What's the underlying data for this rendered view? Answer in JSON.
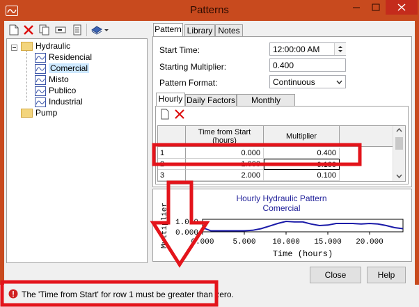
{
  "window": {
    "title": "Patterns"
  },
  "toolbar": {
    "icons": [
      "new-document-icon",
      "delete-icon",
      "copy-icon",
      "rename-icon",
      "properties-icon",
      "library-icon",
      "chevron-down-icon"
    ]
  },
  "tree": {
    "root": "Hydraulic",
    "items": [
      "Residencial",
      "Comercial",
      "Misto",
      "Publico",
      "Industrial"
    ],
    "selected": "Comercial",
    "other": "Pump"
  },
  "tabs": {
    "pattern": "Pattern",
    "library": "Library",
    "notes": "Notes"
  },
  "form": {
    "start_time_label": "Start Time:",
    "start_time": "12:00:00 AM",
    "multiplier_label": "Starting Multiplier:",
    "multiplier": "0.400",
    "format_label": "Pattern Format:",
    "format": "Continuous"
  },
  "subtabs": {
    "hourly": "Hourly",
    "daily": "Daily Factors",
    "monthly": "Monthly Factors"
  },
  "table": {
    "headers": [
      "Time from Start\n(hours)",
      "Multiplier"
    ],
    "rows": [
      {
        "index": "1",
        "time": "0.000",
        "multiplier": "0.400"
      },
      {
        "index": "2",
        "time": "1.000",
        "multiplier": "0.100"
      },
      {
        "index": "3",
        "time": "2.000",
        "multiplier": "0.100"
      }
    ]
  },
  "chart_data": {
    "type": "line",
    "title": "Hourly Hydraulic Pattern",
    "subtitle": "Comercial",
    "xlabel": "Time (hours)",
    "ylabel": "Multiplier",
    "xlim": [
      0,
      24
    ],
    "ylim": [
      0,
      1.2
    ],
    "xticks": [
      "0.000",
      "5.000",
      "10.000",
      "15.000",
      "20.000"
    ],
    "yticks": [
      "0.000",
      "1.000"
    ],
    "x": [
      0,
      1,
      2,
      3,
      4,
      5,
      6,
      7,
      8,
      9,
      10,
      11,
      12,
      13,
      14,
      15,
      16,
      17,
      18,
      19,
      20,
      21,
      22,
      23,
      24
    ],
    "values": [
      0.4,
      0.1,
      0.1,
      0.1,
      0.1,
      0.1,
      0.15,
      0.3,
      0.55,
      0.8,
      1.0,
      0.95,
      0.95,
      0.75,
      0.6,
      0.65,
      0.8,
      0.8,
      0.8,
      0.75,
      0.8,
      0.75,
      0.6,
      0.4,
      0.3
    ]
  },
  "buttons": {
    "close": "Close",
    "help": "Help"
  },
  "status": {
    "message": "The 'Time from Start' for row 1 must be greater than zero."
  },
  "colors": {
    "title_bar": "#c84a1e",
    "annotation_red": "#e3141b",
    "plot_line": "#1a1aa8"
  }
}
